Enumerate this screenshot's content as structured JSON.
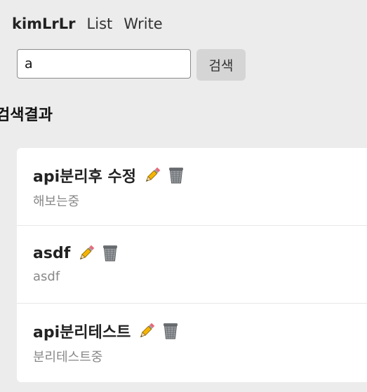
{
  "nav": {
    "brand": "kimLrLr",
    "links": [
      {
        "label": "List"
      },
      {
        "label": "Write"
      }
    ]
  },
  "search": {
    "value": "a",
    "button_label": "검색"
  },
  "results": {
    "heading": "검색결과",
    "items": [
      {
        "title": "api분리후 수정",
        "content": "해보는중",
        "edit_icon": "pencil-icon",
        "delete_icon": "wastebasket-icon"
      },
      {
        "title": "asdf",
        "content": "asdf",
        "edit_icon": "pencil-icon",
        "delete_icon": "wastebasket-icon"
      },
      {
        "title": "api분리테스트",
        "content": "분리테스트중",
        "edit_icon": "pencil-icon",
        "delete_icon": "wastebasket-icon"
      }
    ]
  }
}
